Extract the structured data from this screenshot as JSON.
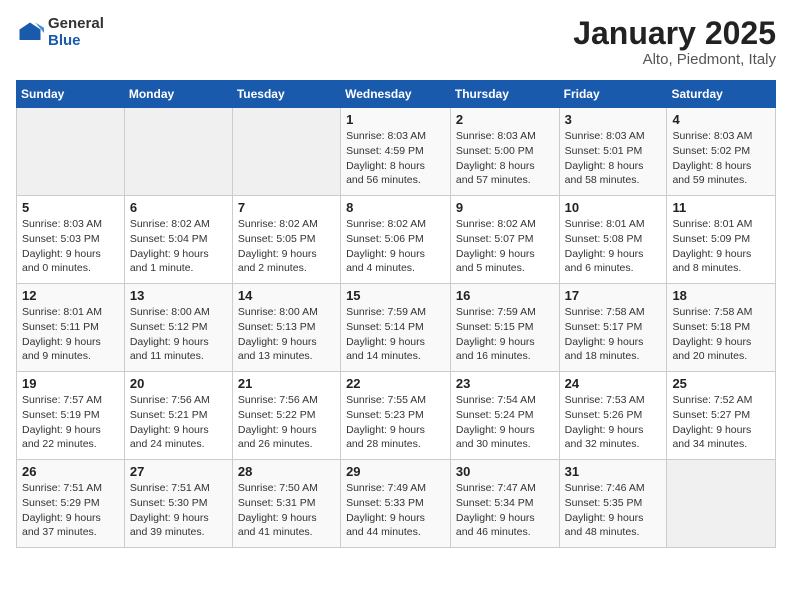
{
  "logo": {
    "general": "General",
    "blue": "Blue"
  },
  "header": {
    "title": "January 2025",
    "subtitle": "Alto, Piedmont, Italy"
  },
  "weekdays": [
    "Sunday",
    "Monday",
    "Tuesday",
    "Wednesday",
    "Thursday",
    "Friday",
    "Saturday"
  ],
  "weeks": [
    [
      {
        "day": "",
        "info": ""
      },
      {
        "day": "",
        "info": ""
      },
      {
        "day": "",
        "info": ""
      },
      {
        "day": "1",
        "info": "Sunrise: 8:03 AM\nSunset: 4:59 PM\nDaylight: 8 hours\nand 56 minutes."
      },
      {
        "day": "2",
        "info": "Sunrise: 8:03 AM\nSunset: 5:00 PM\nDaylight: 8 hours\nand 57 minutes."
      },
      {
        "day": "3",
        "info": "Sunrise: 8:03 AM\nSunset: 5:01 PM\nDaylight: 8 hours\nand 58 minutes."
      },
      {
        "day": "4",
        "info": "Sunrise: 8:03 AM\nSunset: 5:02 PM\nDaylight: 8 hours\nand 59 minutes."
      }
    ],
    [
      {
        "day": "5",
        "info": "Sunrise: 8:03 AM\nSunset: 5:03 PM\nDaylight: 9 hours\nand 0 minutes."
      },
      {
        "day": "6",
        "info": "Sunrise: 8:02 AM\nSunset: 5:04 PM\nDaylight: 9 hours\nand 1 minute."
      },
      {
        "day": "7",
        "info": "Sunrise: 8:02 AM\nSunset: 5:05 PM\nDaylight: 9 hours\nand 2 minutes."
      },
      {
        "day": "8",
        "info": "Sunrise: 8:02 AM\nSunset: 5:06 PM\nDaylight: 9 hours\nand 4 minutes."
      },
      {
        "day": "9",
        "info": "Sunrise: 8:02 AM\nSunset: 5:07 PM\nDaylight: 9 hours\nand 5 minutes."
      },
      {
        "day": "10",
        "info": "Sunrise: 8:01 AM\nSunset: 5:08 PM\nDaylight: 9 hours\nand 6 minutes."
      },
      {
        "day": "11",
        "info": "Sunrise: 8:01 AM\nSunset: 5:09 PM\nDaylight: 9 hours\nand 8 minutes."
      }
    ],
    [
      {
        "day": "12",
        "info": "Sunrise: 8:01 AM\nSunset: 5:11 PM\nDaylight: 9 hours\nand 9 minutes."
      },
      {
        "day": "13",
        "info": "Sunrise: 8:00 AM\nSunset: 5:12 PM\nDaylight: 9 hours\nand 11 minutes."
      },
      {
        "day": "14",
        "info": "Sunrise: 8:00 AM\nSunset: 5:13 PM\nDaylight: 9 hours\nand 13 minutes."
      },
      {
        "day": "15",
        "info": "Sunrise: 7:59 AM\nSunset: 5:14 PM\nDaylight: 9 hours\nand 14 minutes."
      },
      {
        "day": "16",
        "info": "Sunrise: 7:59 AM\nSunset: 5:15 PM\nDaylight: 9 hours\nand 16 minutes."
      },
      {
        "day": "17",
        "info": "Sunrise: 7:58 AM\nSunset: 5:17 PM\nDaylight: 9 hours\nand 18 minutes."
      },
      {
        "day": "18",
        "info": "Sunrise: 7:58 AM\nSunset: 5:18 PM\nDaylight: 9 hours\nand 20 minutes."
      }
    ],
    [
      {
        "day": "19",
        "info": "Sunrise: 7:57 AM\nSunset: 5:19 PM\nDaylight: 9 hours\nand 22 minutes."
      },
      {
        "day": "20",
        "info": "Sunrise: 7:56 AM\nSunset: 5:21 PM\nDaylight: 9 hours\nand 24 minutes."
      },
      {
        "day": "21",
        "info": "Sunrise: 7:56 AM\nSunset: 5:22 PM\nDaylight: 9 hours\nand 26 minutes."
      },
      {
        "day": "22",
        "info": "Sunrise: 7:55 AM\nSunset: 5:23 PM\nDaylight: 9 hours\nand 28 minutes."
      },
      {
        "day": "23",
        "info": "Sunrise: 7:54 AM\nSunset: 5:24 PM\nDaylight: 9 hours\nand 30 minutes."
      },
      {
        "day": "24",
        "info": "Sunrise: 7:53 AM\nSunset: 5:26 PM\nDaylight: 9 hours\nand 32 minutes."
      },
      {
        "day": "25",
        "info": "Sunrise: 7:52 AM\nSunset: 5:27 PM\nDaylight: 9 hours\nand 34 minutes."
      }
    ],
    [
      {
        "day": "26",
        "info": "Sunrise: 7:51 AM\nSunset: 5:29 PM\nDaylight: 9 hours\nand 37 minutes."
      },
      {
        "day": "27",
        "info": "Sunrise: 7:51 AM\nSunset: 5:30 PM\nDaylight: 9 hours\nand 39 minutes."
      },
      {
        "day": "28",
        "info": "Sunrise: 7:50 AM\nSunset: 5:31 PM\nDaylight: 9 hours\nand 41 minutes."
      },
      {
        "day": "29",
        "info": "Sunrise: 7:49 AM\nSunset: 5:33 PM\nDaylight: 9 hours\nand 44 minutes."
      },
      {
        "day": "30",
        "info": "Sunrise: 7:47 AM\nSunset: 5:34 PM\nDaylight: 9 hours\nand 46 minutes."
      },
      {
        "day": "31",
        "info": "Sunrise: 7:46 AM\nSunset: 5:35 PM\nDaylight: 9 hours\nand 48 minutes."
      },
      {
        "day": "",
        "info": ""
      }
    ]
  ]
}
